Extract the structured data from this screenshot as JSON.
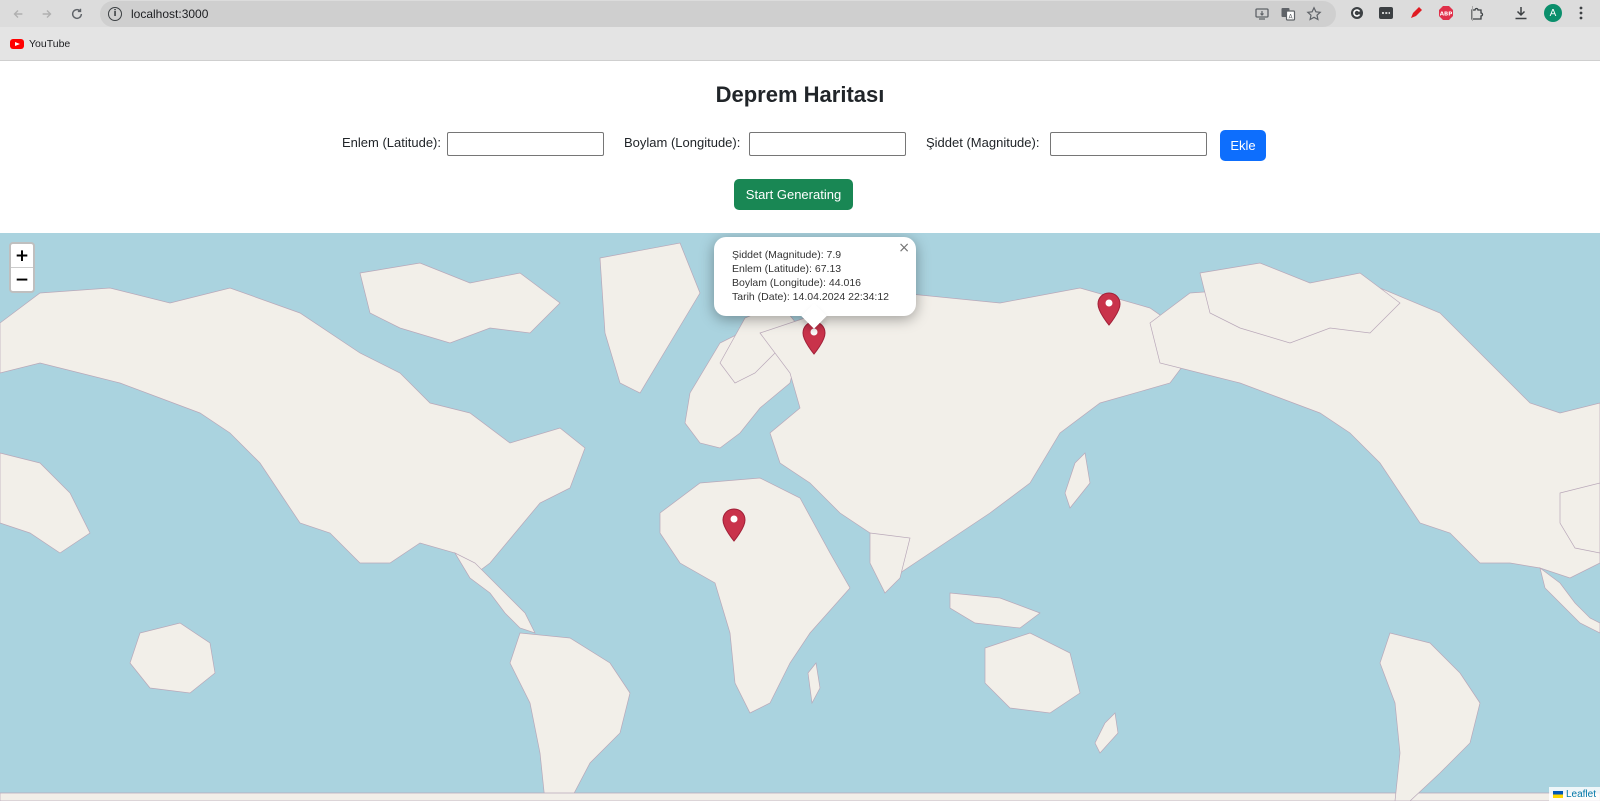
{
  "browser": {
    "url": "localhost:3000",
    "bookmarks": [
      {
        "label": "YouTube",
        "icon": "youtube-icon"
      }
    ],
    "avatar_letter": "A",
    "icons": [
      "back-icon",
      "forward-icon",
      "reload-icon",
      "info-icon",
      "install-icon",
      "translate-icon",
      "star-icon",
      "extension-icon",
      "menu-icon",
      "pen-icon",
      "abp-icon",
      "puzzle-icon",
      "download-icon",
      "more-vert-icon"
    ]
  },
  "page": {
    "title": "Deprem Haritası",
    "form": {
      "lat_label": "Enlem (Latitude):",
      "lng_label": "Boylam (Longitude):",
      "mag_label": "Şiddet (Magnitude):",
      "lat_value": "",
      "lng_value": "",
      "mag_value": "",
      "add_button": "Ekle"
    },
    "start_button": "Start Generating"
  },
  "map": {
    "zoom_in": "+",
    "zoom_out": "−",
    "marker_color": "#c9334b",
    "popup": {
      "magnitude": "Şiddet (Magnitude): 7.9",
      "latitude": "Enlem (Latitude): 67.13",
      "longitude": "Boylam (Longitude): 44.016",
      "date": "Tarih (Date): 14.04.2024 22:34:12",
      "close": "×"
    },
    "attribution": "Leaflet",
    "colors": {
      "water": "#aad3df",
      "land": "#f2efe9",
      "border": "#b9a8b9"
    }
  }
}
